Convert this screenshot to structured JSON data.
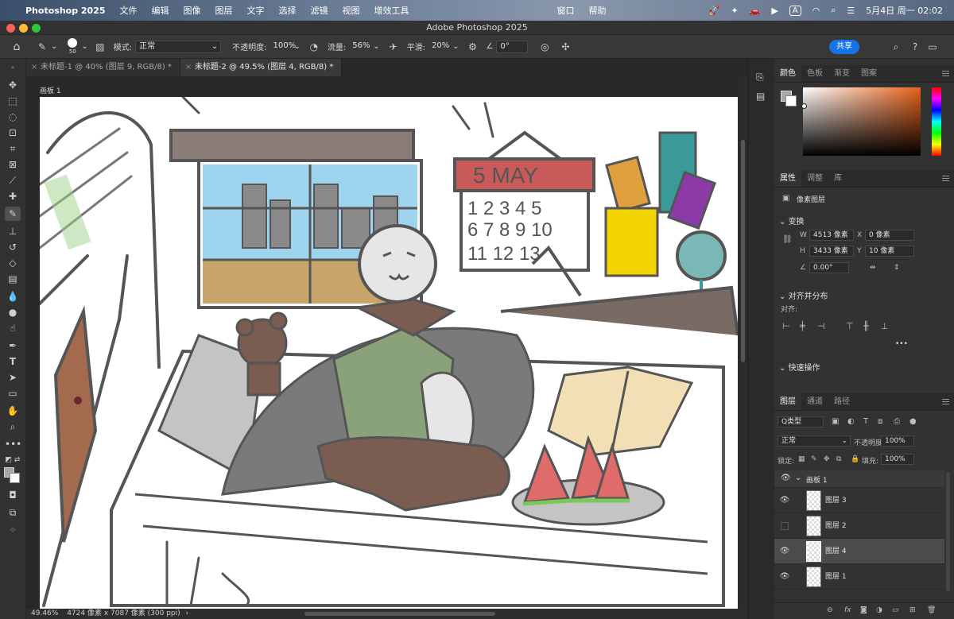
{
  "menubar": {
    "app_name": "Photoshop 2025",
    "items": [
      "文件",
      "编辑",
      "图像",
      "图层",
      "文字",
      "选择",
      "滤镜",
      "视图",
      "增效工具",
      "窗口",
      "帮助"
    ],
    "clock": "5月4日 周一  02:02",
    "input_method": "A"
  },
  "window": {
    "title": "Adobe Photoshop 2025"
  },
  "options_bar": {
    "brush_size": "50",
    "mode_label": "模式:",
    "mode_value": "正常",
    "opacity_label": "不透明度:",
    "opacity_value": "100%",
    "flow_label": "流量:",
    "flow_value": "56%",
    "smoothing_label": "平滑:",
    "smoothing_value": "20%",
    "angle_value": "0°",
    "share_label": "共享"
  },
  "tabs": [
    {
      "label": "未标题-1 @ 40% (图层 9, RGB/8) *",
      "active": false
    },
    {
      "label": "未标题-2 @ 49.5% (图层 4, RGB/8) *",
      "active": true
    }
  ],
  "canvas": {
    "artboard_label": "画板 1",
    "calendar_month": "5 MAY",
    "calendar_rows": [
      "1 2 3 4 5",
      "6 7 8 9 10",
      "11 12 13"
    ]
  },
  "status_bar": {
    "zoom": "49.46%",
    "doc_info": "4724 像素 x 7087 像素 (300 ppi)"
  },
  "color_panel": {
    "tabs": [
      "颜色",
      "色板",
      "渐变",
      "图案"
    ],
    "active": "颜色"
  },
  "properties_panel": {
    "tabs": [
      "属性",
      "调整",
      "库"
    ],
    "active": "属性",
    "layer_type": "像素图层",
    "transform_title": "变换",
    "w_label": "W",
    "w_value": "4513 像素",
    "h_label": "H",
    "h_value": "3433 像素",
    "x_label": "X",
    "x_value": "0 像素",
    "y_label": "Y",
    "y_value": "10 像素",
    "angle_value": "0.00°",
    "align_title": "对齐并分布",
    "align_label": "对齐:",
    "quick_actions": "快速操作",
    "more": "•••"
  },
  "layers_panel": {
    "tabs": [
      "图层",
      "通道",
      "路径"
    ],
    "active": "图层",
    "filter_label": "Q类型",
    "blend_mode": "正常",
    "opacity_label": "不透明度:",
    "opacity_value": "100%",
    "lock_label": "锁定:",
    "fill_label": "填充:",
    "fill_value": "100%",
    "group_name": "画板 1",
    "layers": [
      {
        "name": "图层 3",
        "visible": true,
        "selected": false
      },
      {
        "name": "图层 2",
        "visible": false,
        "selected": false
      },
      {
        "name": "图层 4",
        "visible": true,
        "selected": true
      },
      {
        "name": "图层 1",
        "visible": true,
        "selected": false
      }
    ]
  },
  "colors": {
    "accent": "#1473e6",
    "ps_panel": "#323232",
    "canvas_bg": "#ffffff",
    "watermelon_red": "#e06b6b",
    "watermelon_green": "#7ac85a",
    "calendar_red": "#c95a5a",
    "sky_blue": "#9fd4ef"
  }
}
